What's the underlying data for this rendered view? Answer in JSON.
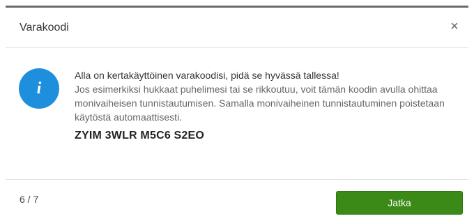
{
  "dialog": {
    "title": "Varakoodi",
    "close_label": "×",
    "info_icon_glyph": "i",
    "headline": "Alla on kertakäyttöinen varakoodisi, pidä se hyvässä tallessa!",
    "description": "Jos esimerkiksi hukkaat puhelimesi tai se rikkoutuu, voit tämän koodin avulla ohittaa monivaiheisen tunnistautumisen. Samalla monivaiheinen tunnistautuminen poistetaan käytöstä automaattisesti.",
    "code": "ZYIM 3WLR M5C6 S2EO",
    "step": "6 / 7",
    "continue_label": "Jatka"
  },
  "colors": {
    "accent": "#1e8fdc",
    "button": "#3b8a17",
    "top_border": "#6b6b6b"
  },
  "icons": {
    "close": "close-icon",
    "info": "info-icon"
  }
}
